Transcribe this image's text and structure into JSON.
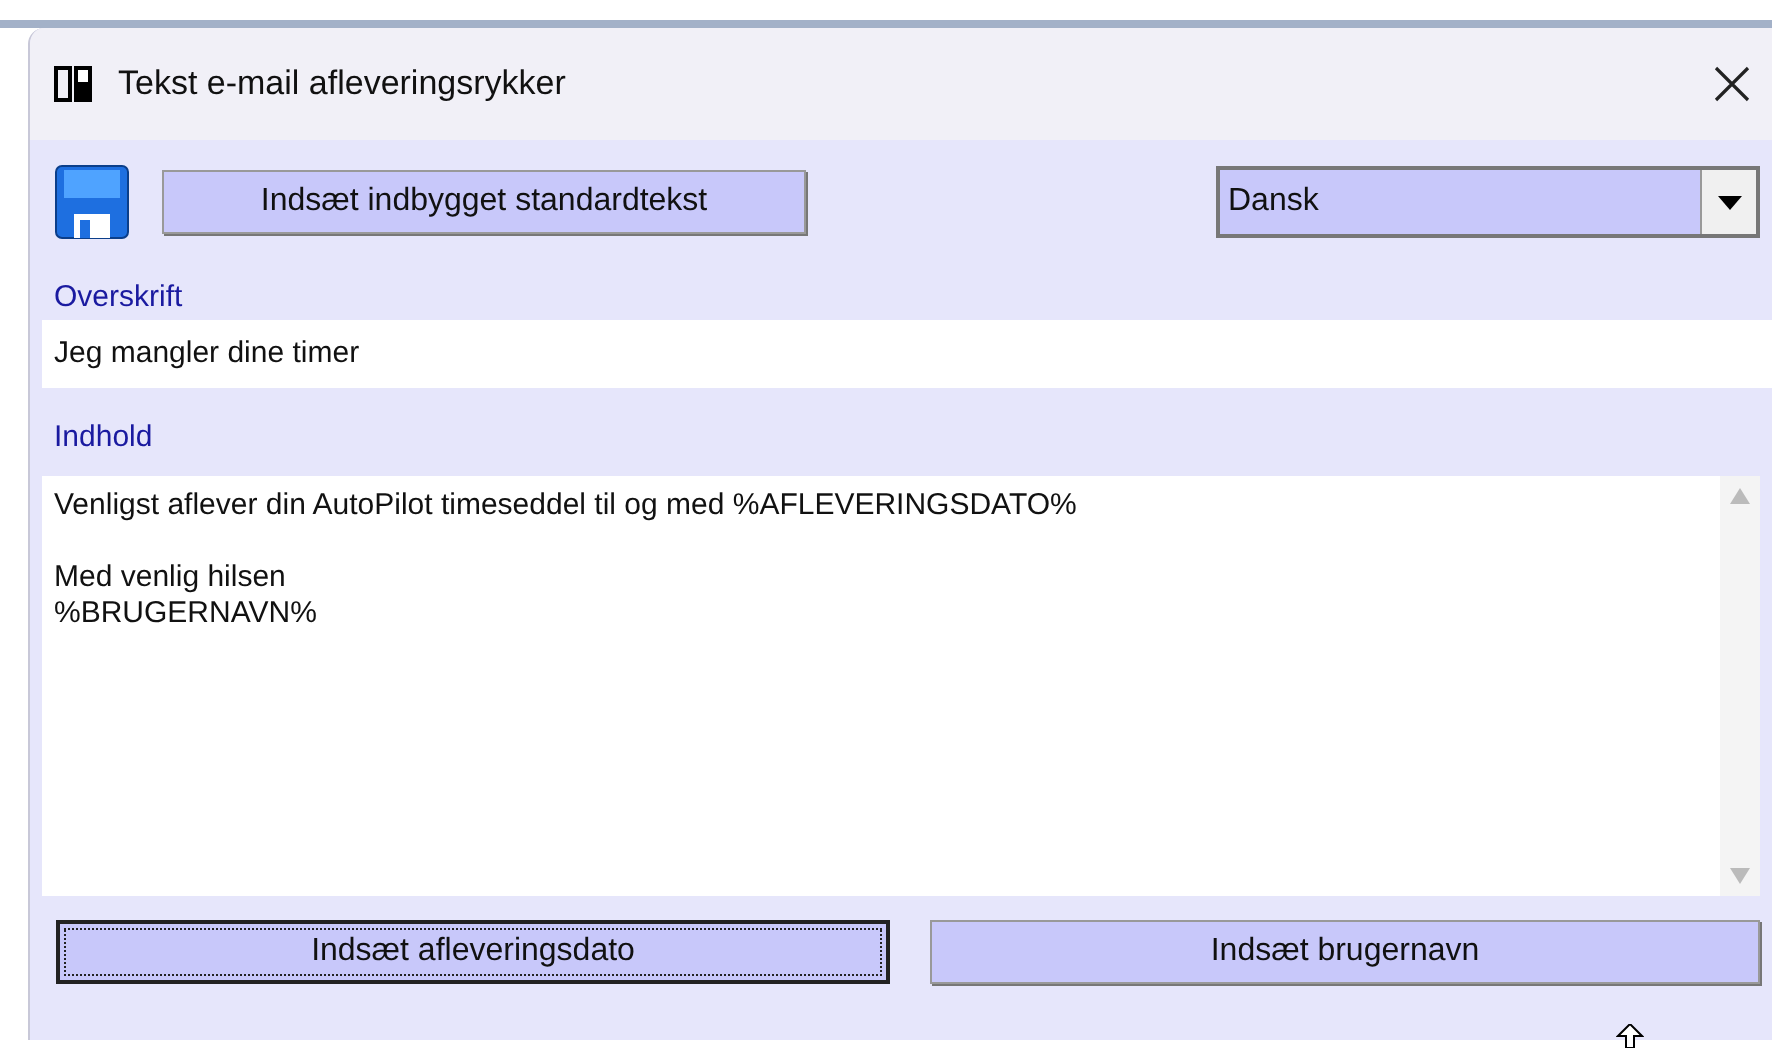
{
  "window": {
    "title": "Tekst e-mail afleveringsrykker"
  },
  "toolbar": {
    "insert_button": "Indsæt indbygget standardtekst",
    "language": {
      "value": "Dansk"
    }
  },
  "subject": {
    "label": "Overskrift",
    "value": "Jeg mangler dine timer"
  },
  "body": {
    "label": "Indhold",
    "paragraphs": [
      [
        "Venligst aflever din AutoPilot timeseddel til og med %AFLEVERINGSDATO%"
      ],
      [
        "Med venlig hilsen",
        "%BRUGERNAVN%"
      ]
    ]
  },
  "buttons": [
    {
      "label": "Indsæt afleveringsdato",
      "focused": true
    },
    {
      "label": "Indsæt brugernavn",
      "focused": false
    }
  ]
}
